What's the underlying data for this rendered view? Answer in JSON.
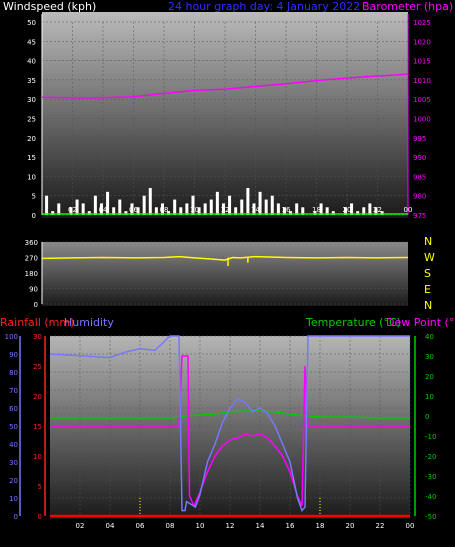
{
  "header": {
    "windspeed_label": "Windspeed (kph)",
    "title": "24 hour graph day:  4 January 2022",
    "barometer_label": "Barometer (hpa)",
    "rainfall_label": "Rainfall (mm)",
    "humidity_label": "Humidity",
    "temperature_label": "Temperature (°C)",
    "dewpoint_label": "Dew Point (°C)"
  },
  "colors": {
    "windspeed": "#ffffff",
    "windspeed_max": "#00ff00",
    "barometer": "#ff00ff",
    "winddir": "#ffff00",
    "rainfall": "#ff0000",
    "humidity": "#7777ff",
    "temperature": "#00cc00",
    "dewpoint": "#ff00ff",
    "time_tick": "#ffff00"
  },
  "chart_data": [
    {
      "type": "line",
      "name": "wind-barometer",
      "x_ticks": [
        "02",
        "04",
        "06",
        "08",
        "10",
        "12",
        "14",
        "16",
        "18",
        "20",
        "22",
        "00"
      ],
      "xlim": [
        0,
        24
      ],
      "ylim_left": [
        0,
        50
      ],
      "yticks_left": [
        "0",
        "5",
        "10",
        "15",
        "20",
        "25",
        "30",
        "35",
        "40",
        "45",
        "50"
      ],
      "ylim_right": [
        975,
        1025
      ],
      "yticks_right": [
        "975",
        "980",
        "985",
        "990",
        "995",
        "1000",
        "1005",
        "1010",
        "1015",
        "1020",
        "1025"
      ],
      "barometer": {
        "x": [
          0,
          3,
          6,
          8,
          10,
          12,
          14,
          16,
          18,
          20,
          22,
          24
        ],
        "y": [
          1005.5,
          1005.3,
          1005.6,
          1006.5,
          1007.3,
          1007.6,
          1008.3,
          1009.0,
          1009.8,
          1010.5,
          1011.0,
          1011.5
        ]
      },
      "windspeed_bars": {
        "x": [
          0.3,
          0.7,
          1.1,
          1.5,
          1.9,
          2.3,
          2.7,
          3.1,
          3.5,
          3.9,
          4.3,
          4.7,
          5.1,
          5.5,
          5.9,
          6.3,
          6.7,
          7.1,
          7.5,
          7.9,
          8.3,
          8.7,
          9.1,
          9.5,
          9.9,
          10.3,
          10.7,
          11.1,
          11.5,
          11.9,
          12.3,
          12.7,
          13.1,
          13.5,
          13.9,
          14.3,
          14.7,
          15.1,
          15.5,
          15.9,
          16.3,
          16.7,
          17.1,
          17.5,
          17.9,
          18.3,
          18.7,
          19.1,
          19.5,
          19.9,
          20.3,
          20.7,
          21.1,
          21.5,
          21.9,
          22.3,
          22.7
        ],
        "y": [
          5,
          1,
          3,
          0,
          2,
          4,
          3,
          1,
          5,
          3,
          6,
          2,
          4,
          1,
          3,
          2,
          5,
          7,
          2,
          3,
          1,
          4,
          2,
          3,
          5,
          2,
          3,
          4,
          6,
          3,
          5,
          2,
          4,
          7,
          3,
          6,
          4,
          5,
          3,
          2,
          1,
          3,
          2,
          0,
          1,
          3,
          2,
          1,
          0,
          2,
          3,
          1,
          2,
          3,
          2,
          1,
          0
        ]
      }
    },
    {
      "type": "line",
      "name": "wind-direction",
      "ylim": [
        0,
        360
      ],
      "yticks": [
        "0",
        "90",
        "180",
        "270",
        "360"
      ],
      "compass_labels": [
        "N",
        "W",
        "S",
        "E",
        "N"
      ],
      "x": [
        0,
        2,
        4,
        6,
        8,
        9,
        10,
        11,
        12,
        12.5,
        13,
        14,
        16,
        18,
        20,
        22,
        24
      ],
      "y": [
        265,
        268,
        270,
        268,
        270,
        275,
        268,
        262,
        255,
        270,
        268,
        275,
        270,
        268,
        270,
        268,
        270
      ]
    },
    {
      "type": "line",
      "name": "rain-humidity-temperature",
      "x_ticks": [
        "02",
        "04",
        "06",
        "08",
        "10",
        "12",
        "14",
        "16",
        "18",
        "20",
        "22",
        "00"
      ],
      "xlim": [
        0,
        24
      ],
      "ylim_humidity": [
        0,
        100
      ],
      "yticks_humidity": [
        "0",
        "10",
        "20",
        "30",
        "40",
        "50",
        "60",
        "70",
        "80",
        "90",
        "100"
      ],
      "ylim_rain": [
        0,
        30
      ],
      "yticks_rain": [
        "0",
        "5",
        "10",
        "15",
        "20",
        "25",
        "30"
      ],
      "ylim_temp": [
        -50,
        40
      ],
      "yticks_temp": [
        "-50",
        "-40",
        "-30",
        "-20",
        "-10",
        "0",
        "10",
        "20",
        "30",
        "40"
      ],
      "humidity": {
        "x": [
          0,
          2,
          4,
          5,
          6,
          7,
          8,
          8.6,
          8.8,
          9,
          9.1,
          9.3,
          9.7,
          10,
          10.5,
          11,
          11.5,
          12,
          12.5,
          13,
          13.5,
          14,
          14.5,
          15,
          15.5,
          16,
          16.5,
          16.8,
          17,
          17.2,
          18,
          20,
          22,
          24
        ],
        "y": [
          90,
          89,
          88,
          91,
          93,
          92,
          100,
          100,
          3,
          3,
          8,
          7,
          5,
          12,
          30,
          40,
          52,
          60,
          65,
          63,
          58,
          60,
          57,
          50,
          40,
          30,
          10,
          3,
          5,
          100,
          100,
          100,
          100,
          100
        ]
      },
      "temperature": {
        "x": [
          0,
          2,
          4,
          6,
          8,
          9,
          10,
          11,
          12,
          13,
          14,
          15,
          16,
          17,
          18,
          20,
          22,
          24
        ],
        "y": [
          -1,
          -1,
          -1,
          -1,
          -1,
          0,
          0.5,
          1,
          2,
          2.5,
          2.5,
          2,
          1,
          0,
          -0.5,
          -0.5,
          -1,
          -1
        ]
      },
      "dewpoint": {
        "x": [
          0,
          2,
          4,
          6,
          8,
          8.6,
          8.8,
          9.2,
          9.3,
          9.6,
          10,
          10.5,
          11,
          11.5,
          12,
          12.5,
          13,
          13.5,
          14,
          14.5,
          15,
          15.5,
          16,
          16.5,
          16.8,
          17,
          17.2,
          18,
          20,
          22,
          24
        ],
        "y": [
          -5,
          -5,
          -5,
          -5,
          -5,
          -5,
          30,
          30,
          -40,
          -45,
          -38,
          -28,
          -20,
          -15,
          -12,
          -11,
          -9,
          -10,
          -9,
          -11,
          -15,
          -20,
          -28,
          -40,
          -45,
          25,
          -5,
          -5,
          -5,
          -5,
          -5
        ]
      },
      "rainfall": {
        "x": [
          0,
          24
        ],
        "y": [
          0,
          0
        ]
      },
      "sun_markers_hours": [
        6,
        18
      ]
    }
  ]
}
